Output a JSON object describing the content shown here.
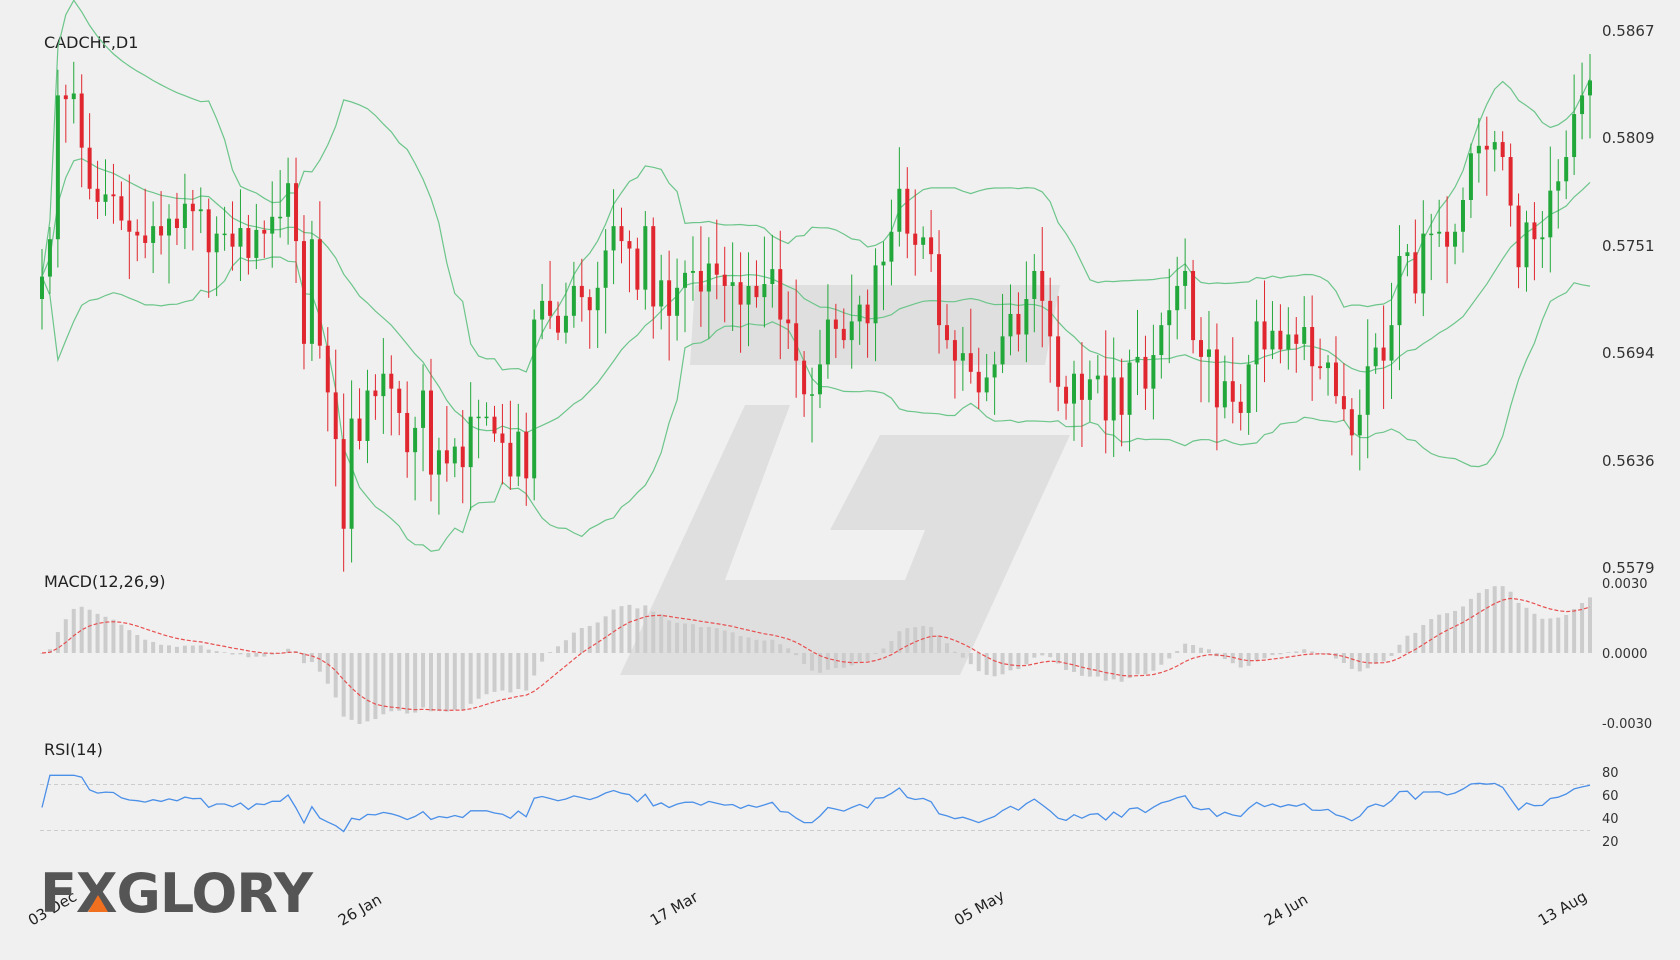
{
  "panels": {
    "price_title": "CADCHF,D1",
    "macd_title": "MACD(12,26,9)",
    "rsi_title": "RSI(14)"
  },
  "price_ticks": [
    "0.5867",
    "0.5809",
    "0.5751",
    "0.5694",
    "0.5636",
    "0.5579"
  ],
  "macd_ticks": [
    "0.0030",
    "0.0000",
    "-0.0030"
  ],
  "rsi_ticks": [
    "80",
    "60",
    "40",
    "20"
  ],
  "x_ticks": [
    "03 Dec",
    "26 Jan",
    "17 Mar",
    "05 May",
    "24 Jun",
    "13 Aug"
  ],
  "logo": {
    "text": "FXGLORY"
  },
  "colors": {
    "up": "#22a83a",
    "down": "#e0262e",
    "band": "#6cc58a",
    "macd_signal": "#e85050",
    "histogram": "#cccccc",
    "rsi": "#4a8fe8",
    "background": "#f0f0f0"
  },
  "chart_data": [
    {
      "type": "candlestick",
      "title": "CADCHF,D1",
      "x_tick_labels": [
        "03 Dec",
        "26 Jan",
        "17 Mar",
        "05 May",
        "24 Jun",
        "13 Aug"
      ],
      "ylim": [
        0.5579,
        0.5867
      ],
      "overlay": "Bollinger Bands",
      "close": [
        0.5735,
        0.5755,
        0.5832,
        0.583,
        0.5833,
        0.5804,
        0.5782,
        0.5775,
        0.5779,
        0.5778,
        0.5765,
        0.5759,
        0.5757,
        0.5753,
        0.5762,
        0.5757,
        0.5766,
        0.5761,
        0.5774,
        0.577,
        0.5771,
        0.5748,
        0.5758,
        0.5758,
        0.5751,
        0.5761,
        0.5745,
        0.576,
        0.5758,
        0.5767,
        0.5767,
        0.5785,
        0.5754,
        0.5699,
        0.5755,
        0.5698,
        0.5673,
        0.5648,
        0.56,
        0.5659,
        0.5647,
        0.5674,
        0.5671,
        0.5683,
        0.5675,
        0.5662,
        0.5641,
        0.5654,
        0.5674,
        0.5629,
        0.5642,
        0.5635,
        0.5644,
        0.5633,
        0.566,
        0.566,
        0.566,
        0.5651,
        0.5646,
        0.5628,
        0.5652,
        0.5627,
        0.5712,
        0.5722,
        0.5714,
        0.5705,
        0.5714,
        0.573,
        0.5724,
        0.5717,
        0.5729,
        0.5749,
        0.5762,
        0.5754,
        0.575,
        0.5728,
        0.5762,
        0.5719,
        0.5733,
        0.5714,
        0.5729,
        0.5737,
        0.5738,
        0.5727,
        0.5742,
        0.5736,
        0.573,
        0.5732,
        0.572,
        0.573,
        0.5724,
        0.5731,
        0.5739,
        0.5712,
        0.571,
        0.569,
        0.5672,
        0.5672,
        0.5688,
        0.5712,
        0.5707,
        0.5701,
        0.5711,
        0.572,
        0.571,
        0.5741,
        0.5743,
        0.5759,
        0.5782,
        0.5758,
        0.5752,
        0.5756,
        0.5747,
        0.5709,
        0.5701,
        0.569,
        0.5694,
        0.5684,
        0.5673,
        0.5681,
        0.5688,
        0.5703,
        0.5715,
        0.5704,
        0.5723,
        0.5738,
        0.5722,
        0.5703,
        0.5676,
        0.5667,
        0.5683,
        0.5669,
        0.568,
        0.5682,
        0.5658,
        0.5681,
        0.5661,
        0.5689,
        0.5692,
        0.5675,
        0.5693,
        0.5709,
        0.5717,
        0.573,
        0.5738,
        0.5701,
        0.5692,
        0.5696,
        0.5665,
        0.5679,
        0.5668,
        0.5662,
        0.5688,
        0.5711,
        0.5696,
        0.5706,
        0.5696,
        0.5704,
        0.5699,
        0.5708,
        0.5687,
        0.5686,
        0.5689,
        0.5671,
        0.5664,
        0.565,
        0.5661,
        0.5687,
        0.5697,
        0.569,
        0.5709,
        0.5746,
        0.5748,
        0.5726,
        0.5758,
        0.5758,
        0.5759,
        0.5751,
        0.5759,
        0.5776,
        0.5801,
        0.5805,
        0.5803,
        0.5807,
        0.5799,
        0.5773,
        0.574,
        0.5764,
        0.5755,
        0.5756,
        0.5781,
        0.5786,
        0.5799,
        0.5822,
        0.5832,
        0.584
      ]
    },
    {
      "type": "line",
      "title": "MACD(12,26,9)",
      "ylim": [
        -0.003,
        0.003
      ],
      "series": [
        "signal line",
        "histogram"
      ]
    },
    {
      "type": "line",
      "title": "RSI(14)",
      "ylim": [
        20,
        80
      ],
      "y_ticks": [
        80,
        60,
        40,
        20
      ],
      "levels": [
        70,
        30
      ]
    }
  ]
}
